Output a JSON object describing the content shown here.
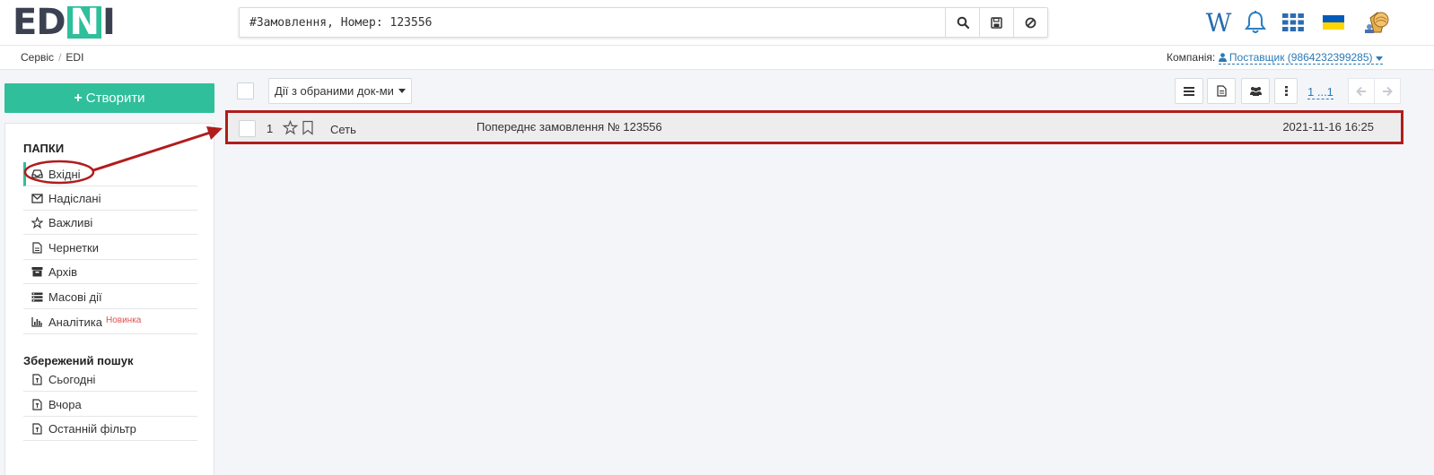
{
  "header": {
    "logo": {
      "part1": "ED",
      "part2": "N",
      "part3": "I"
    },
    "search_value": "#Замовлення, Номер: 123556",
    "wiki_glyph": "W",
    "icons": [
      "search-icon",
      "save-icon",
      "clear-icon",
      "wiki-icon",
      "bell-icon",
      "apps-grid-icon",
      "ukraine-flag-icon",
      "avatar-icon"
    ],
    "flag_colors": {
      "top": "#005BBB",
      "bottom": "#FFD500"
    }
  },
  "breadcrumb": {
    "items": [
      "Сервіс",
      "EDI"
    ],
    "separator": "/"
  },
  "company": {
    "label": "Компанія:",
    "value": "Поставщик (9864232399285)"
  },
  "sidebar": {
    "create_label": "Створити",
    "folders_title": "ПАПКИ",
    "folders": [
      {
        "label": "Вхідні",
        "icon": "inbox-icon",
        "active": true
      },
      {
        "label": "Надіслані",
        "icon": "envelope-icon"
      },
      {
        "label": "Важливі",
        "icon": "star-icon"
      },
      {
        "label": "Чернетки",
        "icon": "draft-icon"
      },
      {
        "label": "Архів",
        "icon": "archive-icon"
      },
      {
        "label": "Масові дії",
        "icon": "bulk-actions-icon"
      },
      {
        "label": "Аналітика",
        "icon": "chart-icon",
        "badge": "Новинка"
      }
    ],
    "saved_title": "Збережений пошук",
    "saved": [
      {
        "label": "Сьогодні",
        "icon": "filter-file-icon"
      },
      {
        "label": "Вчора",
        "icon": "filter-file-icon"
      },
      {
        "label": "Останній фільтр",
        "icon": "filter-file-icon"
      }
    ]
  },
  "toolbar": {
    "bulk_actions_label": "Дії з обраними док-ми",
    "pagination_label": "1 ...1",
    "icons": [
      "list-icon",
      "document-icon",
      "group-icon",
      "more-vertical-icon",
      "arrow-left-icon",
      "arrow-right-icon"
    ]
  },
  "documents": [
    {
      "number": "1",
      "sender": "Сеть",
      "title": "Попереднє замовлення № 123556",
      "date": "2021-11-16 16:25"
    }
  ],
  "colors": {
    "accent": "#2fbf9a",
    "link": "#2a7ab7",
    "annotation": "#b11c1c",
    "badge": "#e05252"
  }
}
